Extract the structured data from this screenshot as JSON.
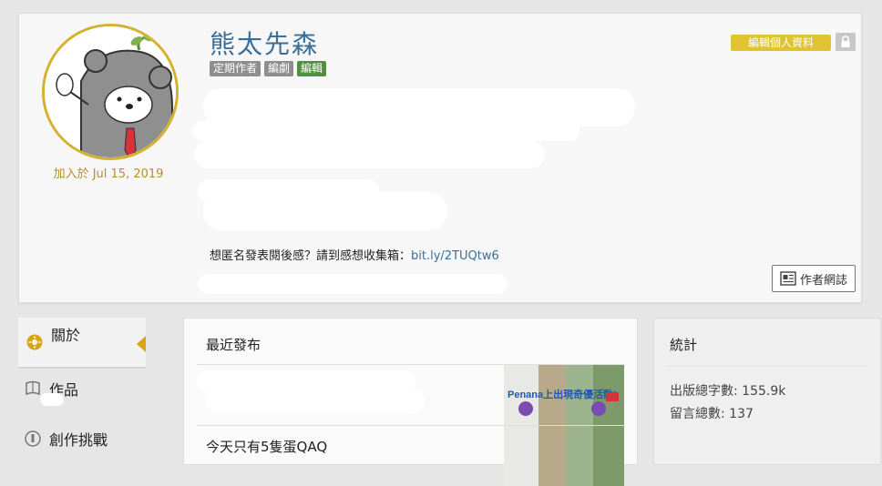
{
  "profile": {
    "name": "熊太先森",
    "tags": [
      "定期作者",
      "編劇",
      "編輯"
    ],
    "joined": "加入於 Jul 15, 2019",
    "contact_text": "想匿名發表閱後感？請到感想收集箱：",
    "contact_link": "bit.ly/2TUQtw6",
    "edit_profile_label": "編輯個人資料",
    "author_blog_label": "作者網誌",
    "icons": {
      "lock": "lock-icon",
      "blog": "blog-icon"
    },
    "colors": {
      "name": "#3a6f9a",
      "accent": "#e0c332",
      "avatar_border": "#d6b12f"
    }
  },
  "sidebar": {
    "items": [
      {
        "label": "關於",
        "icon": "about-icon",
        "active": true
      },
      {
        "label": "作品",
        "icon": "works-icon",
        "active": false
      },
      {
        "label": "創作挑戰",
        "icon": "challenge-icon",
        "active": false
      }
    ]
  },
  "recent": {
    "title": "最近發布",
    "items": [
      {
        "title": "",
        "thumb_text": "Penana上出現奇優活動!"
      },
      {
        "title": "今天只有5隻蛋QAQ",
        "thumb_text": ""
      }
    ]
  },
  "stats": {
    "title": "統計",
    "words_label": "出版總字數:",
    "words_value": "155.9k",
    "comments_label": "留言總數:",
    "comments_value": "137"
  }
}
